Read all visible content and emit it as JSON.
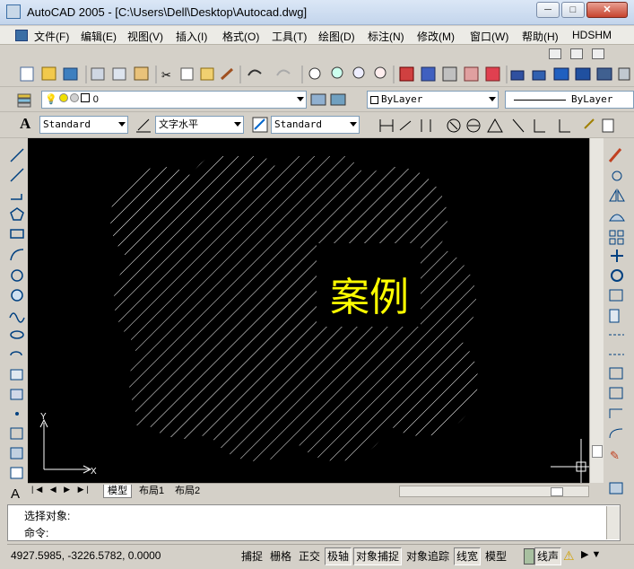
{
  "window": {
    "title": "AutoCAD 2005 - [C:\\Users\\Dell\\Desktop\\Autocad.dwg]",
    "minimize": "─",
    "maximize": "□",
    "close": "✕"
  },
  "menu": [
    "文件(F)",
    "编辑(E)",
    "视图(V)",
    "插入(I)",
    "格式(O)",
    "工具(T)",
    "绘图(D)",
    "标注(N)",
    "修改(M)",
    "窗口(W)",
    "帮助(H)",
    "HDSHM"
  ],
  "layer": {
    "current": "0"
  },
  "properties": {
    "color": "ByLayer",
    "linetype": "ByLayer"
  },
  "styles": {
    "text_style": "Standard",
    "text_mode": "文字水平",
    "dim_style": "Standard"
  },
  "drawing": {
    "label": "案例",
    "label_color": "#ffff00",
    "hatch_color": "#ffffff",
    "ucs_x": "X",
    "ucs_y": "Y"
  },
  "tabs": [
    "模型",
    "布局1",
    "布局2"
  ],
  "command": {
    "line1": "选择对象:",
    "line2": "命令:"
  },
  "status": {
    "coords": "4927.5985,  -3226.5782,  0.0000",
    "toggles": [
      "捕捉",
      "栅格",
      "正交",
      "极轴",
      "对象捕捉",
      "对象追踪",
      "线宽",
      "模型"
    ],
    "tray": "线声"
  }
}
